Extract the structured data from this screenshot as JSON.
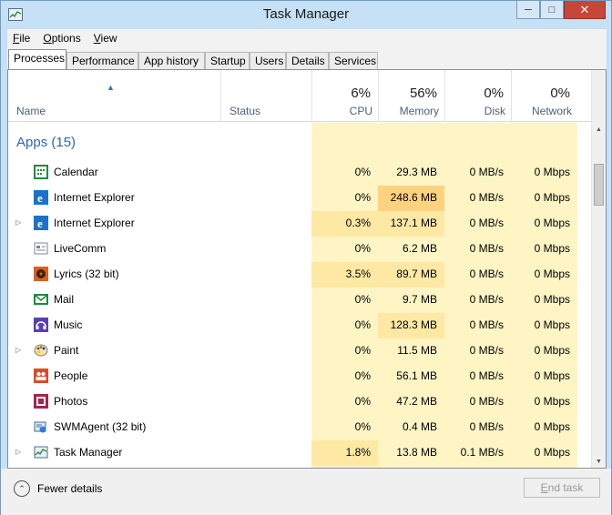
{
  "window": {
    "title": "Task Manager"
  },
  "menu": {
    "items": [
      {
        "key": "F",
        "rest": "ile"
      },
      {
        "key": "O",
        "rest": "ptions"
      },
      {
        "key": "V",
        "rest": "iew"
      }
    ]
  },
  "tabs": [
    "Processes",
    "Performance",
    "App history",
    "Startup",
    "Users",
    "Details",
    "Services"
  ],
  "columns": {
    "name": "Name",
    "status": "Status",
    "cpu": {
      "pct": "6%",
      "label": "CPU"
    },
    "memory": {
      "pct": "56%",
      "label": "Memory"
    },
    "disk": {
      "pct": "0%",
      "label": "Disk"
    },
    "network": {
      "pct": "0%",
      "label": "Network"
    }
  },
  "group_label": "Apps (15)",
  "rows": [
    {
      "name": "Calendar",
      "icon": "calendar-icon",
      "expandable": false,
      "cpu": "0%",
      "memory": "29.3 MB",
      "disk": "0 MB/s",
      "network": "0 Mbps"
    },
    {
      "name": "Internet Explorer",
      "icon": "internet-explorer-icon",
      "expandable": false,
      "cpu": "0%",
      "memory": "248.6 MB",
      "disk": "0 MB/s",
      "network": "0 Mbps"
    },
    {
      "name": "Internet Explorer",
      "icon": "internet-explorer-icon",
      "expandable": true,
      "cpu": "0.3%",
      "memory": "137.1 MB",
      "disk": "0 MB/s",
      "network": "0 Mbps"
    },
    {
      "name": "LiveComm",
      "icon": "livecomm-icon",
      "expandable": false,
      "cpu": "0%",
      "memory": "6.2 MB",
      "disk": "0 MB/s",
      "network": "0 Mbps"
    },
    {
      "name": "Lyrics (32 bit)",
      "icon": "music-disc-icon",
      "expandable": false,
      "cpu": "3.5%",
      "memory": "89.7 MB",
      "disk": "0 MB/s",
      "network": "0 Mbps"
    },
    {
      "name": "Mail",
      "icon": "mail-icon",
      "expandable": false,
      "cpu": "0%",
      "memory": "9.7 MB",
      "disk": "0 MB/s",
      "network": "0 Mbps"
    },
    {
      "name": "Music",
      "icon": "headphones-icon",
      "expandable": false,
      "cpu": "0%",
      "memory": "128.3 MB",
      "disk": "0 MB/s",
      "network": "0 Mbps"
    },
    {
      "name": "Paint",
      "icon": "paint-palette-icon",
      "expandable": true,
      "cpu": "0%",
      "memory": "11.5 MB",
      "disk": "0 MB/s",
      "network": "0 Mbps"
    },
    {
      "name": "People",
      "icon": "people-icon",
      "expandable": false,
      "cpu": "0%",
      "memory": "56.1 MB",
      "disk": "0 MB/s",
      "network": "0 Mbps"
    },
    {
      "name": "Photos",
      "icon": "photos-icon",
      "expandable": false,
      "cpu": "0%",
      "memory": "47.2 MB",
      "disk": "0 MB/s",
      "network": "0 Mbps"
    },
    {
      "name": "SWMAgent (32 bit)",
      "icon": "swmagent-icon",
      "expandable": false,
      "cpu": "0%",
      "memory": "0.4 MB",
      "disk": "0 MB/s",
      "network": "0 Mbps"
    },
    {
      "name": "Task Manager",
      "icon": "task-manager-icon",
      "expandable": true,
      "cpu": "1.8%",
      "memory": "13.8 MB",
      "disk": "0.1 MB/s",
      "network": "0 Mbps"
    }
  ],
  "footer": {
    "fewer_details": "Fewer details",
    "end_task": {
      "key": "E",
      "rest": "nd task"
    }
  },
  "colors": {
    "heat_light": "#fff4c4",
    "heat_mid": "#ffe8a4",
    "heat_high": "#ffd280",
    "accent": "#2e66b8"
  }
}
